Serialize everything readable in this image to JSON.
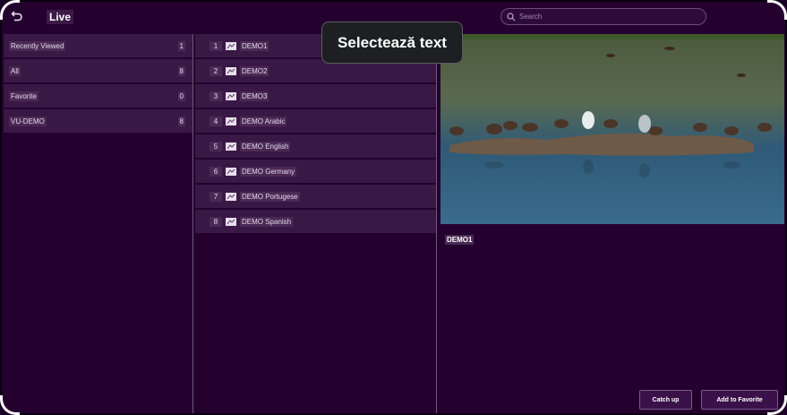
{
  "header": {
    "title": "Live",
    "search_placeholder": "Search"
  },
  "categories": [
    {
      "label": "Recently Viewed",
      "count": "1"
    },
    {
      "label": "All",
      "count": "8"
    },
    {
      "label": "Favorite",
      "count": "0"
    },
    {
      "label": "VU-DEMO",
      "count": "8"
    }
  ],
  "channels": [
    {
      "num": "1",
      "name": "DEMO1"
    },
    {
      "num": "2",
      "name": "DEMO2"
    },
    {
      "num": "3",
      "name": "DEMO3"
    },
    {
      "num": "4",
      "name": "DEMO Arabic"
    },
    {
      "num": "5",
      "name": "DEMO English"
    },
    {
      "num": "6",
      "name": "DEMO Germany"
    },
    {
      "num": "7",
      "name": "DEMO Portugese"
    },
    {
      "num": "8",
      "name": "DEMO Spanish"
    }
  ],
  "preview": {
    "now_playing": "DEMO1",
    "catchup_label": "Catch up",
    "favorite_label": "Add to Favorite"
  },
  "tooltip": {
    "text": "Selectează text"
  },
  "icons": {
    "back": "back-arrow-icon",
    "search": "search-icon",
    "channel_logo": "channel-logo-icon"
  },
  "colors": {
    "background": "#24002f",
    "item": "#3a1845",
    "button": "#3a1148"
  }
}
